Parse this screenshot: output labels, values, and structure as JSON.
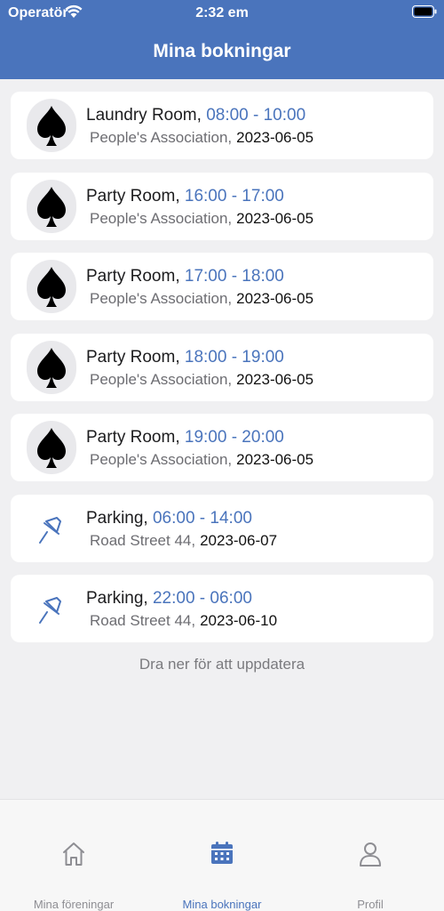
{
  "status_bar": {
    "carrier": "Operatör",
    "time": "2:32 em"
  },
  "header": {
    "title": "Mina bokningar"
  },
  "bookings": [
    {
      "name": "Laundry Room",
      "time": "08:00 - 10:00",
      "location": "People's Association,",
      "date": "2023-06-05",
      "icon": "spade-icon"
    },
    {
      "name": "Party Room",
      "time": "16:00 - 17:00",
      "location": "People's Association,",
      "date": "2023-06-05",
      "icon": "spade-icon"
    },
    {
      "name": "Party Room",
      "time": "17:00 - 18:00",
      "location": "People's Association,",
      "date": "2023-06-05",
      "icon": "spade-icon"
    },
    {
      "name": "Party Room",
      "time": "18:00 - 19:00",
      "location": "People's Association,",
      "date": "2023-06-05",
      "icon": "spade-icon"
    },
    {
      "name": "Party Room",
      "time": "19:00 - 20:00",
      "location": "People's Association,",
      "date": "2023-06-05",
      "icon": "spade-icon"
    },
    {
      "name": "Parking",
      "time": "06:00 - 14:00",
      "location": "Road Street 44,",
      "date": "2023-06-07",
      "icon": "pin-icon"
    },
    {
      "name": "Parking",
      "time": "22:00 - 06:00",
      "location": "Road Street 44,",
      "date": "2023-06-10",
      "icon": "pin-icon"
    }
  ],
  "pull_hint": "Dra ner för att uppdatera",
  "tabs": [
    {
      "label": "Mina föreningar",
      "icon": "house-icon",
      "active": false
    },
    {
      "label": "Mina bokningar",
      "icon": "calendar-icon",
      "active": true
    },
    {
      "label": "Profil",
      "icon": "person-icon",
      "active": false
    }
  ],
  "colors": {
    "accent": "#4a74bc",
    "background": "#f0f0f2",
    "card": "#ffffff"
  }
}
